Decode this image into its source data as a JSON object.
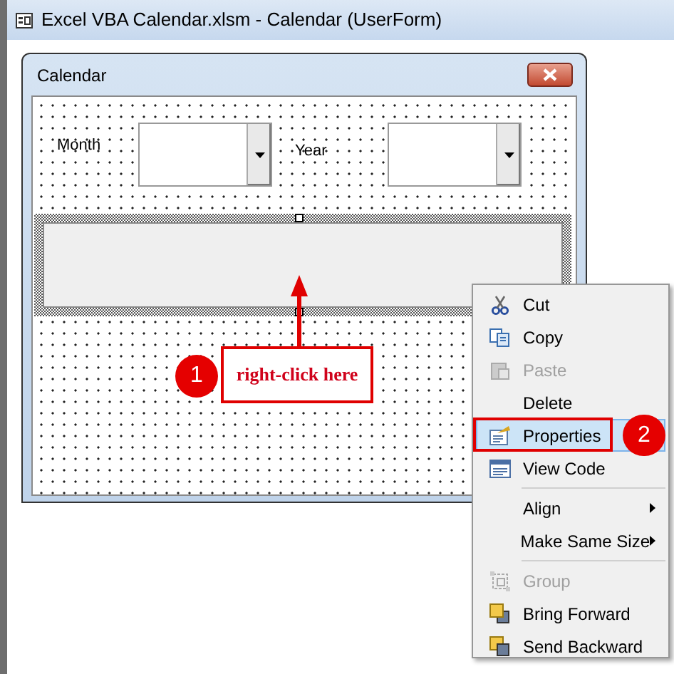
{
  "window": {
    "title": "Excel VBA Calendar.xlsm - Calendar (UserForm)"
  },
  "userform": {
    "title": "Calendar",
    "fields": [
      {
        "label": "Month"
      },
      {
        "label": "Year"
      }
    ]
  },
  "context_menu": [
    {
      "kind": "item",
      "label": "Cut",
      "disabled": false,
      "selected": false
    },
    {
      "kind": "item",
      "label": "Copy",
      "disabled": false,
      "selected": false
    },
    {
      "kind": "item",
      "label": "Paste",
      "disabled": true,
      "selected": false
    },
    {
      "kind": "item",
      "label": "Delete",
      "disabled": false,
      "selected": false
    },
    {
      "kind": "item",
      "label": "Properties",
      "disabled": false,
      "selected": true
    },
    {
      "kind": "item",
      "label": "View Code",
      "disabled": false,
      "selected": false
    },
    {
      "kind": "separator"
    },
    {
      "kind": "submenu",
      "label": "Align",
      "disabled": false,
      "selected": false
    },
    {
      "kind": "submenu",
      "label": "Make Same Size",
      "disabled": false,
      "selected": false
    },
    {
      "kind": "separator"
    },
    {
      "kind": "item",
      "label": "Group",
      "disabled": true,
      "selected": false
    },
    {
      "kind": "item",
      "label": "Bring Forward",
      "disabled": false,
      "selected": false
    },
    {
      "kind": "item",
      "label": "Send Backward",
      "disabled": false,
      "selected": false
    }
  ],
  "callouts": [
    {
      "number": "1",
      "text": "right-click here"
    },
    {
      "number": "2"
    }
  ]
}
